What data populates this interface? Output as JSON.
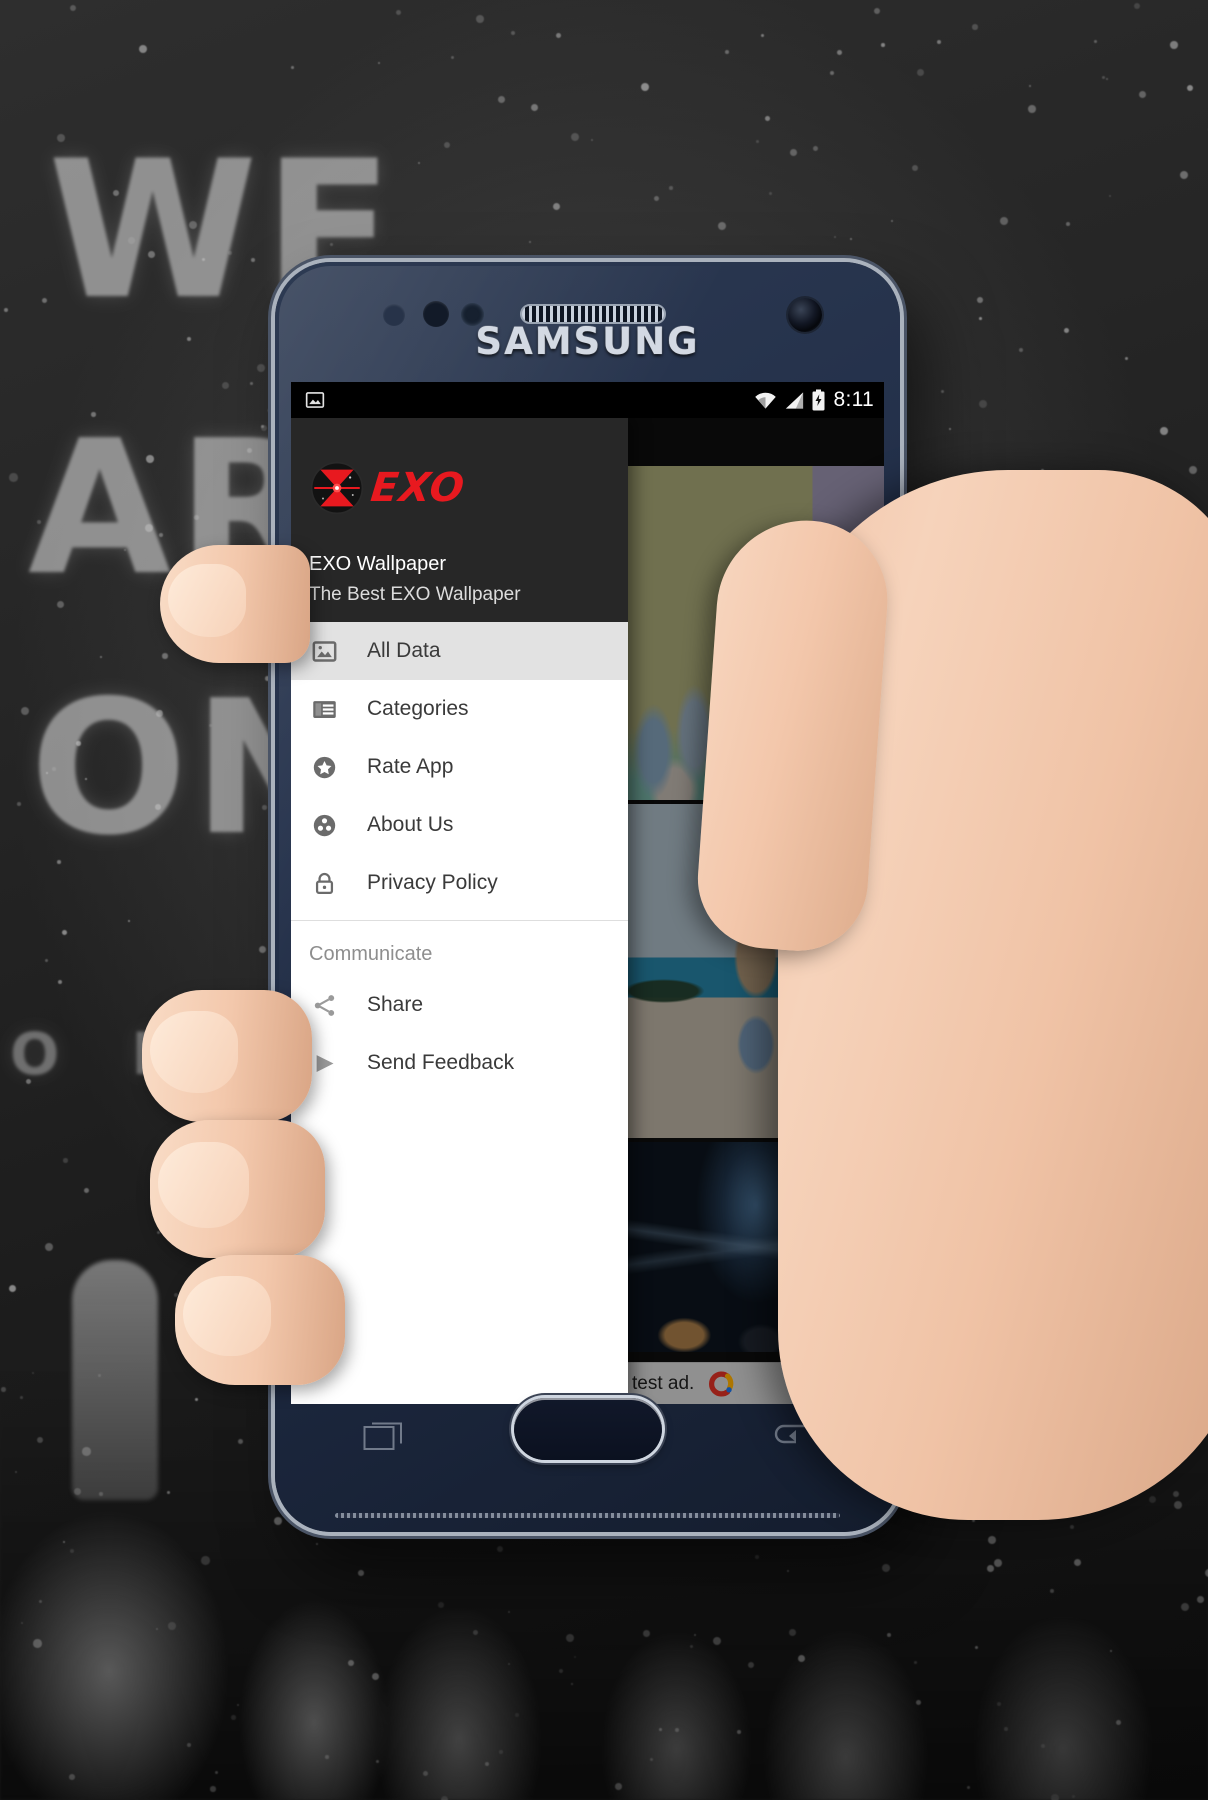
{
  "background": {
    "graffiti_lines": [
      "WE",
      "ARE",
      "ON",
      "O R E"
    ],
    "description": "grayscale graffiti wall with snow speckles and group silhouettes"
  },
  "device": {
    "brand": "SAMSUNG",
    "icons": {
      "earpiece": "speaker-grille-icon",
      "front_camera": "front-camera-icon",
      "proximity_sensor": "proximity-sensor-icon",
      "home": "home-button",
      "recents": "recents-icon",
      "back": "back-icon"
    }
  },
  "status_bar": {
    "notification_icon": "image-notification-icon",
    "wifi_icon": "wifi-icon",
    "signal_icon": "cellular-signal-icon",
    "battery_icon": "battery-charging-icon",
    "time": "8:11"
  },
  "drawer": {
    "logo_text": "EXO",
    "logo_icon": "exo-logo-icon",
    "app_name": "EXO Wallpaper",
    "app_subtitle": "The Best EXO Wallpaper",
    "accent_color": "#e8191f",
    "header_bg": "#272727",
    "selected_bg": "#e2e2e2",
    "items": [
      {
        "label": "All Data",
        "icon": "image-icon",
        "selected": true
      },
      {
        "label": "Categories",
        "icon": "list-alt-icon",
        "selected": false
      },
      {
        "label": "Rate App",
        "icon": "star-circle-icon",
        "selected": false
      },
      {
        "label": "About Us",
        "icon": "group-circle-icon",
        "selected": false
      },
      {
        "label": "Privacy Policy",
        "icon": "lock-icon",
        "selected": false
      }
    ],
    "section_label": "Communicate",
    "communicate_items": [
      {
        "label": "Share",
        "icon": "share-icon"
      },
      {
        "label": "Send Feedback",
        "icon": "send-icon"
      }
    ]
  },
  "content": {
    "wallpapers": [
      {
        "caption": "EXO group photo on pastel wall"
      },
      {
        "caption": "Two members piggyback on beach"
      },
      {
        "caption": "Concert stage with crowd"
      }
    ]
  },
  "ad": {
    "text": "test ad.",
    "logo": "admob-logo-icon"
  }
}
